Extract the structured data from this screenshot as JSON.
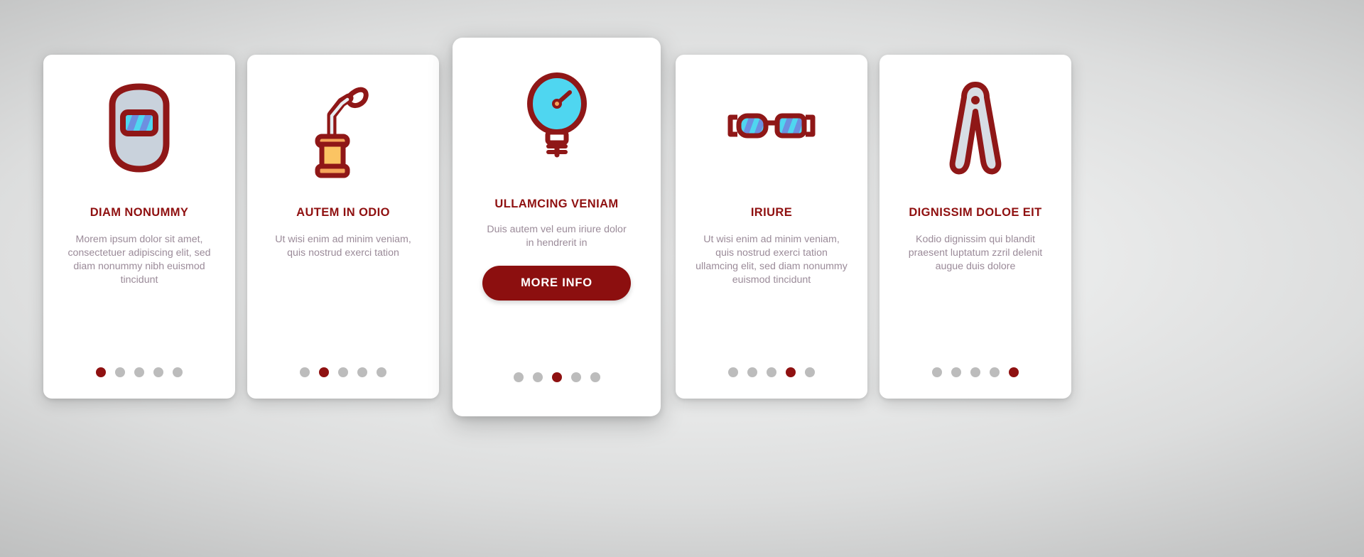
{
  "theme": {
    "accent": "#8f1010",
    "button_bg": "#8c0f0f",
    "body_text": "#9b8b99",
    "dot_inactive": "#bcbcbc",
    "dot_active": "#8f1111",
    "card_bg": "#ffffff",
    "page_bg": "#d8d8d8",
    "icon_outline": "#8f1717",
    "icon_gray": "#c9d2dc",
    "icon_cyan": "#4fd6f0",
    "icon_blue": "#6d8fe0",
    "icon_orange": "#f5a55a",
    "icon_yellow": "#fbc463"
  },
  "cards": [
    {
      "id": "card-1",
      "icon": "welding-mask-icon",
      "title": "DIAM NONUMMY",
      "body": "Morem ipsum dolor sit amet, consectetuer adipiscing elit, sed diam nonummy nibh euismod tincidunt",
      "dots": {
        "count": 5,
        "active_index": 0
      },
      "featured": false
    },
    {
      "id": "card-2",
      "icon": "welding-torch-icon",
      "title": "AUTEM IN ODIO",
      "body": "Ut wisi enim ad minim veniam, quis nostrud exerci tation",
      "dots": {
        "count": 5,
        "active_index": 1
      },
      "featured": false
    },
    {
      "id": "card-3",
      "icon": "pressure-gauge-icon",
      "title": "ULLAMCING VENIAM",
      "body": "Duis autem vel eum iriure dolor in hendrerit in",
      "button_label": "MORE INFO",
      "dots": {
        "count": 5,
        "active_index": 2
      },
      "featured": true
    },
    {
      "id": "card-4",
      "icon": "safety-goggles-icon",
      "title": "IRIURE",
      "body": "Ut wisi enim ad minim veniam, quis nostrud exerci tation ullamcing elit, sed diam nonummy euismod tincidunt",
      "dots": {
        "count": 5,
        "active_index": 3
      },
      "featured": false
    },
    {
      "id": "card-5",
      "icon": "welding-clamp-icon",
      "title": "DIGNISSIM DOLOE EIT",
      "body": "Kodio dignissim qui blandit praesent luptatum zzril delenit augue duis dolore",
      "dots": {
        "count": 5,
        "active_index": 4
      },
      "featured": false
    }
  ]
}
